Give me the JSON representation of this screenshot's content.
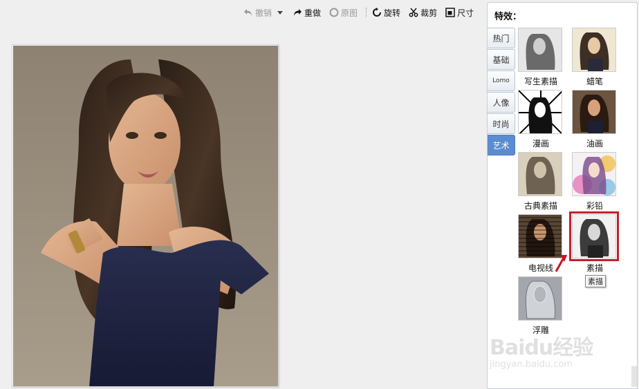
{
  "toolbar": {
    "undo_label": "撤销",
    "redo_label": "重做",
    "original_label": "原图",
    "rotate_label": "旋转",
    "crop_label": "裁剪",
    "resize_label": "尺寸"
  },
  "panel": {
    "title": "特效：",
    "tabs": [
      {
        "label": "热门",
        "active": false
      },
      {
        "label": "基础",
        "active": false
      },
      {
        "label": "Lomo",
        "active": false
      },
      {
        "label": "人像",
        "active": false
      },
      {
        "label": "时尚",
        "active": false
      },
      {
        "label": "艺术",
        "active": true
      }
    ],
    "effects": [
      {
        "label": "写生素描",
        "selected": false
      },
      {
        "label": "蜡笔",
        "selected": false
      },
      {
        "label": "漫画",
        "selected": false
      },
      {
        "label": "油画",
        "selected": false
      },
      {
        "label": "古典素描",
        "selected": false
      },
      {
        "label": "彩铅",
        "selected": false
      },
      {
        "label": "电视线",
        "selected": false
      },
      {
        "label": "素描",
        "selected": true
      },
      {
        "label": "浮雕",
        "selected": false
      }
    ]
  },
  "tooltip": {
    "text": "素描"
  },
  "watermark": {
    "logo": "Baidu经验",
    "url": "jingyan.baidu.com"
  },
  "colors": {
    "accent": "#5b8ccf",
    "highlight": "#c2202f"
  }
}
